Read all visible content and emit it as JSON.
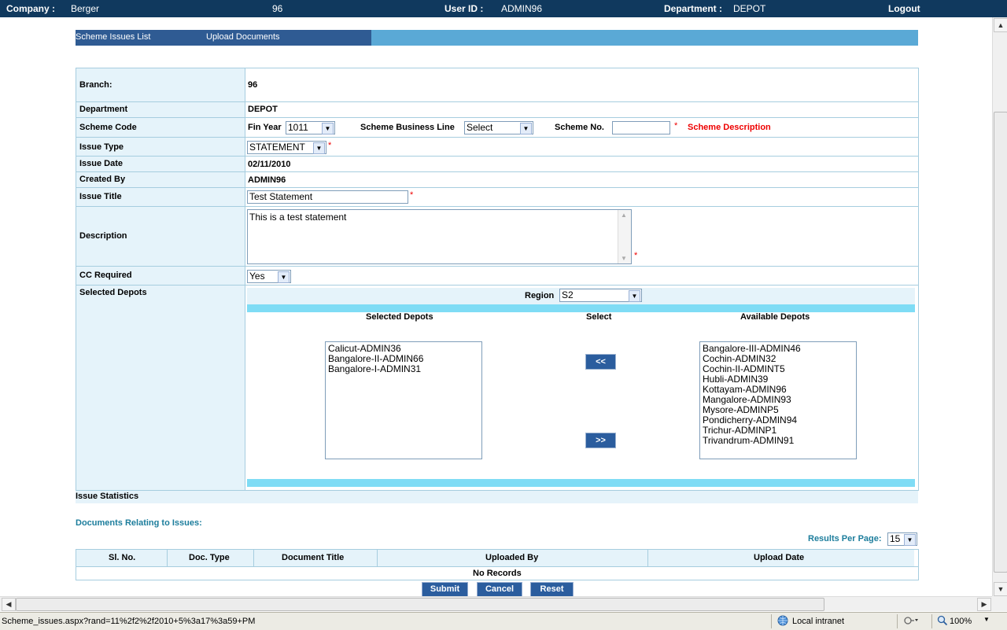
{
  "header": {
    "company_label": "Company :",
    "company_value": "Berger",
    "branch_value": "96",
    "user_label": "User ID :",
    "user_value": "ADMIN96",
    "department_label": "Department :",
    "department_value": "DEPOT",
    "logout_label": "Logout"
  },
  "tabs": {
    "scheme_issues_list": "Scheme Issues List",
    "upload_documents": "Upload Documents"
  },
  "form": {
    "branch_label": "Branch:",
    "branch_value": "96",
    "department_label": "Department",
    "department_value": "DEPOT",
    "scheme_code_label": "Scheme Code",
    "fin_year_label": "Fin Year",
    "fin_year_value": "1011",
    "business_line_label": "Scheme Business Line",
    "business_line_value": "Select",
    "scheme_no_label": "Scheme No.",
    "scheme_no_value": "",
    "scheme_description_label": "Scheme Description",
    "issue_type_label": "Issue Type",
    "issue_type_value": "STATEMENT",
    "issue_date_label": "Issue Date",
    "issue_date_value": "02/11/2010",
    "created_by_label": "Created By",
    "created_by_value": "ADMIN96",
    "issue_title_label": "Issue Title",
    "issue_title_value": "Test Statement",
    "description_label": "Description",
    "description_value": "This is a test statement",
    "cc_required_label": "CC Required",
    "cc_required_value": "Yes",
    "selected_depots_label": "Selected Depots",
    "required_mark": "*"
  },
  "depots": {
    "region_label": "Region",
    "region_value": "S2",
    "selected_header": "Selected  Depots",
    "select_header": "Select",
    "available_header": "Available Depots",
    "move_left_label": "<<",
    "move_right_label": ">>",
    "selected": [
      "Calicut-ADMIN36",
      "Bangalore-II-ADMIN66",
      "Bangalore-I-ADMIN31"
    ],
    "available": [
      "Bangalore-III-ADMIN46",
      "Cochin-ADMIN32",
      "Cochin-II-ADMINT5",
      "Hubli-ADMIN39",
      "Kottayam-ADMIN96",
      "Mangalore-ADMIN93",
      "Mysore-ADMINP5",
      "Pondicherry-ADMIN94",
      "Trichur-ADMINP1",
      "Trivandrum-ADMIN91"
    ]
  },
  "issue_statistics_label": "Issue Statistics",
  "documents": {
    "title": "Documents Relating to Issues:",
    "results_per_page_label": "Results Per Page:",
    "results_per_page_value": "15",
    "columns": [
      "Sl. No.",
      "Doc. Type",
      "Document Title",
      "Uploaded By",
      "Upload Date"
    ],
    "empty_text": "No Records"
  },
  "actions": {
    "submit": "Submit",
    "cancel": "Cancel",
    "reset": "Reset"
  },
  "statusbar": {
    "url": "Scheme_issues.aspx?rand=11%2f2%2f2010+5%3a17%3a59+PM",
    "zone": "Local intranet",
    "zoom": "100%"
  },
  "colors": {
    "header_bg": "#10395e",
    "tab_dark": "#2f5b93",
    "tab_light": "#5aa9d6",
    "label_bg": "#e5f3fa",
    "required": "#e00000",
    "button_bg": "#2b5d9e",
    "heading_teal": "#1c7d9c"
  }
}
